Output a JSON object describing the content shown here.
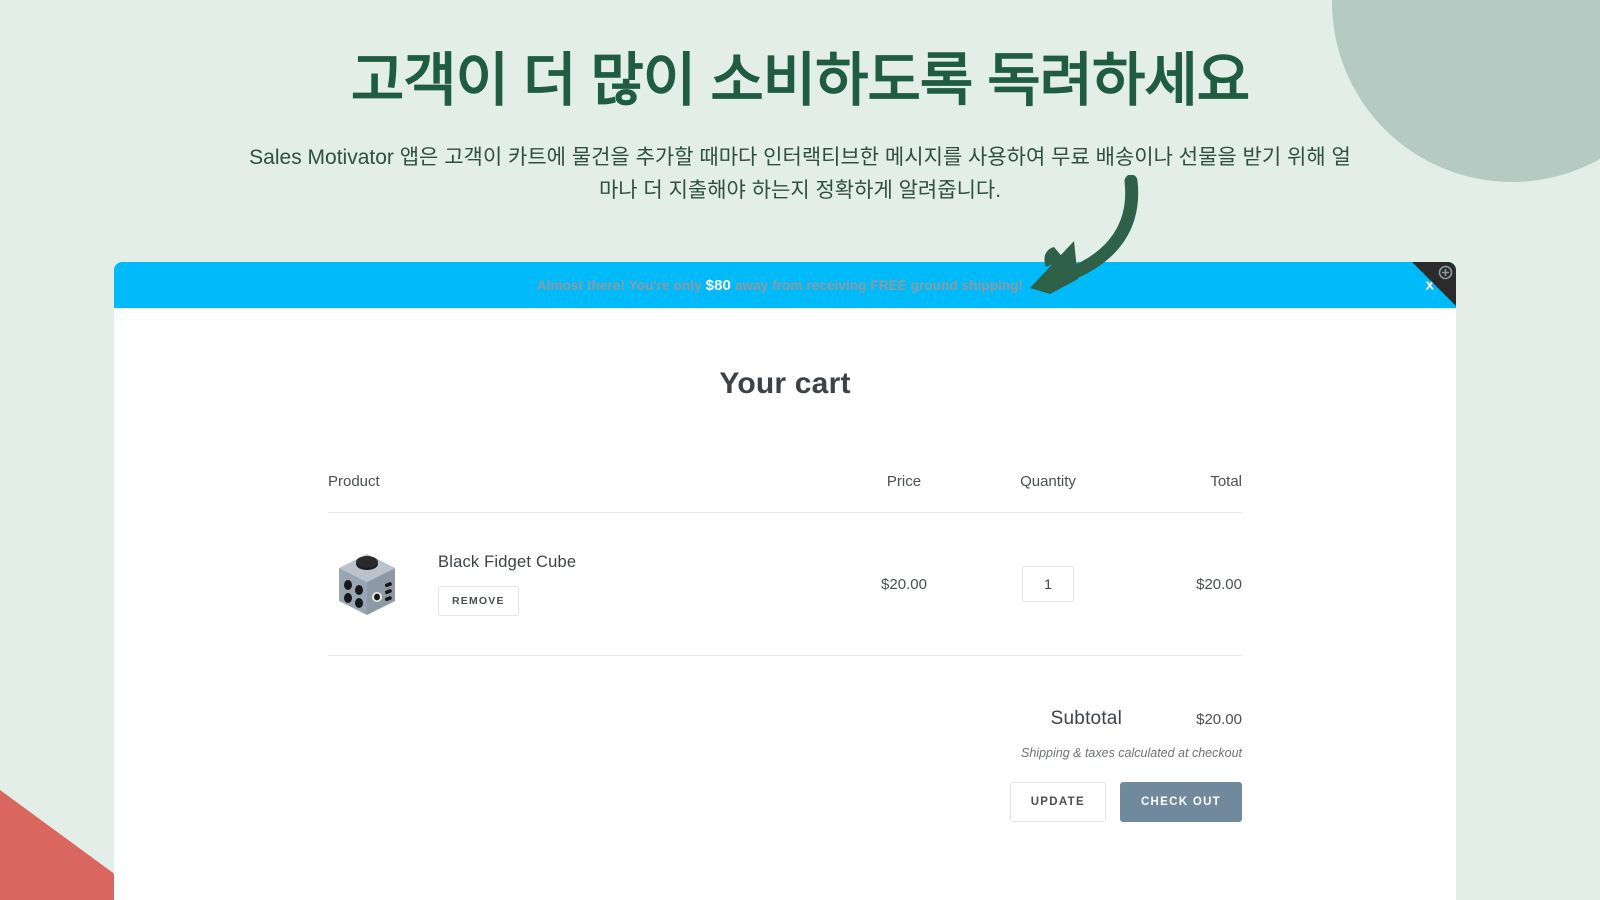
{
  "colors": {
    "page_background": "#e3eee8",
    "deco_circle": "#b4cac2",
    "deco_triangle": "#d9665f",
    "hero_title": "#1f5c42",
    "arrow": "#2f6149",
    "banner_background": "#01bafa",
    "banner_text": "#8f9aa0",
    "banner_amount": "#ffffff",
    "corner_fold": "#2b2b2b",
    "checkout_button": "#70899c",
    "card_background": "#ffffff"
  },
  "hero": {
    "title": "고객이 더 많이 소비하도록 독려하세요",
    "subtitle": "Sales Motivator 앱은 고객이 카트에 물건을 추가할 때마다 인터랙티브한 메시지를 사용하여 무료 배송이나 선물을 받기 위해 얼마나 더 지출해야 하는지 정확하게 알려줍니다."
  },
  "banner": {
    "text_before": "Almost there! You're only",
    "amount": "$80",
    "text_after": "away from receiving FREE ground shipping!",
    "close_label": "x",
    "corner_icon": "gear-icon"
  },
  "cart": {
    "title": "Your cart",
    "columns": {
      "product": "Product",
      "price": "Price",
      "quantity": "Quantity",
      "total": "Total"
    },
    "items": [
      {
        "name": "Black Fidget Cube",
        "remove_label": "REMOVE",
        "price": "$20.00",
        "quantity": "1",
        "total": "$20.00"
      }
    ],
    "subtotal_label": "Subtotal",
    "subtotal_value": "$20.00",
    "tax_note": "Shipping & taxes calculated at checkout",
    "update_label": "UPDATE",
    "checkout_label": "CHECK OUT"
  }
}
